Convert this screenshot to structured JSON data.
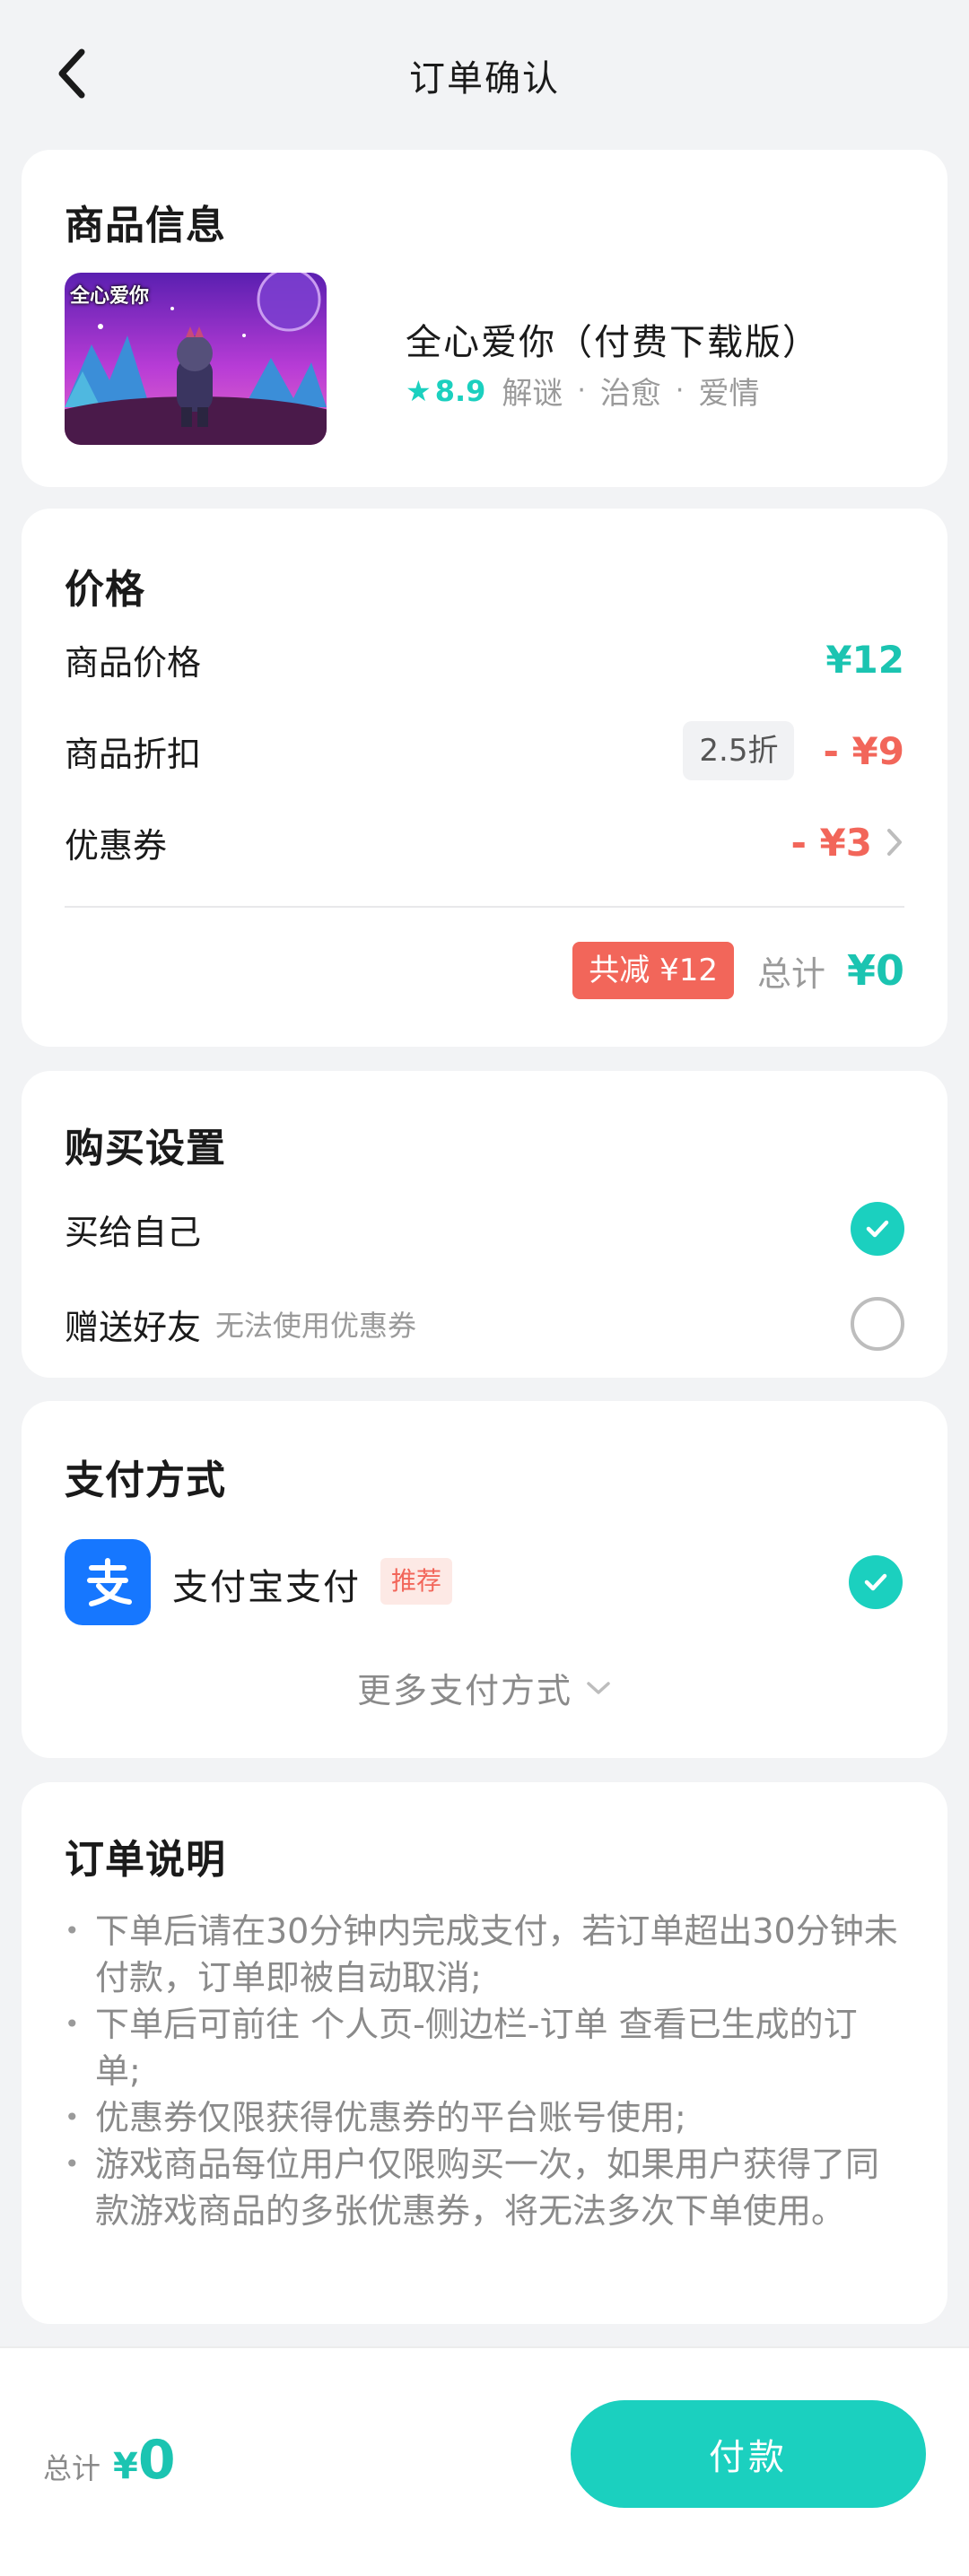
{
  "header": {
    "title": "订单确认"
  },
  "product": {
    "section_title": "商品信息",
    "logo_text": "全心爱你",
    "name": "全心爱你（付费下载版）",
    "rating": "8.9",
    "tags": [
      "解谜",
      "治愈",
      "爱情"
    ]
  },
  "price": {
    "section_title": "价格",
    "item_price_label": "商品价格",
    "item_price_value": "¥12",
    "discount_label": "商品折扣",
    "discount_chip": "2.5折",
    "discount_value": "- ¥9",
    "coupon_label": "优惠券",
    "coupon_value": "- ¥3",
    "saving_badge": "共减 ¥12",
    "total_label": "总计",
    "total_value": "¥0"
  },
  "purchase": {
    "section_title": "购买设置",
    "self_label": "买给自己",
    "self_checked": true,
    "gift_label": "赠送好友",
    "gift_note": "无法使用优惠券",
    "gift_checked": false
  },
  "payment": {
    "section_title": "支付方式",
    "method_name": "支付宝支付",
    "recommend_tag": "推荐",
    "method_checked": true,
    "more_label": "更多支付方式"
  },
  "notes": {
    "section_title": "订单说明",
    "items": [
      "下单后请在30分钟内完成支付，若订单超出30分钟未付款，订单即被自动取消;",
      "下单后可前往 个人页-侧边栏-订单 查看已生成的订单;",
      "优惠券仅限获得优惠券的平台账号使用;",
      "游戏商品每位用户仅限购买一次，如果用户获得了同款游戏商品的多张优惠券，将无法多次下单使用。"
    ]
  },
  "bottom": {
    "total_label": "总计",
    "currency": "¥",
    "total_amount": "0",
    "pay_button": "付款"
  },
  "colors": {
    "accent": "#1bd0bf",
    "price_teal": "#1bc4b1",
    "discount_red": "#f2665a",
    "alipay_blue": "#1677ff",
    "background": "#f2f3f5"
  },
  "icons": {
    "back": "chevron-left-icon",
    "star": "star-icon",
    "coupon_arrow": "chevron-right-icon",
    "check": "check-icon",
    "alipay": "alipay-icon",
    "more": "chevron-down-icon"
  }
}
